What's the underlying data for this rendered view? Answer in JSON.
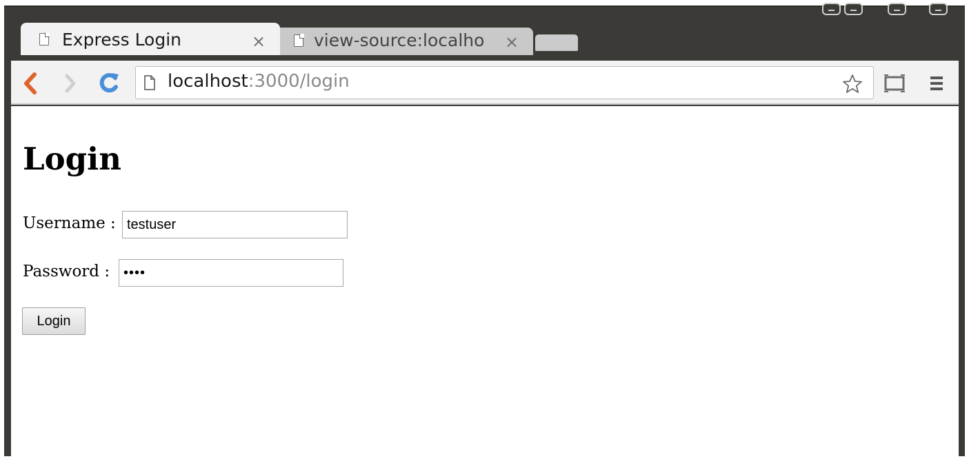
{
  "tabs": [
    {
      "title": "Express Login",
      "close": "×",
      "active": true
    },
    {
      "title": "view-source:localho",
      "close": "×",
      "active": false
    }
  ],
  "address_bar": {
    "host": "localhost",
    "path": ":3000/login"
  },
  "icons": {
    "back": "back-arrow-icon",
    "forward": "forward-arrow-icon",
    "reload": "reload-icon",
    "page": "page-icon",
    "bookmark": "star-icon",
    "cast": "cast-icon",
    "menu": "hamburger-menu-icon"
  },
  "page": {
    "heading": "Login",
    "username_label": "Username :",
    "username_value": "testuser",
    "password_label": "Password :",
    "password_value": "••••",
    "submit_label": "Login"
  },
  "colors": {
    "back_arrow": "#e0632c",
    "reload": "#4a90d9",
    "frame": "#3b3a36"
  }
}
